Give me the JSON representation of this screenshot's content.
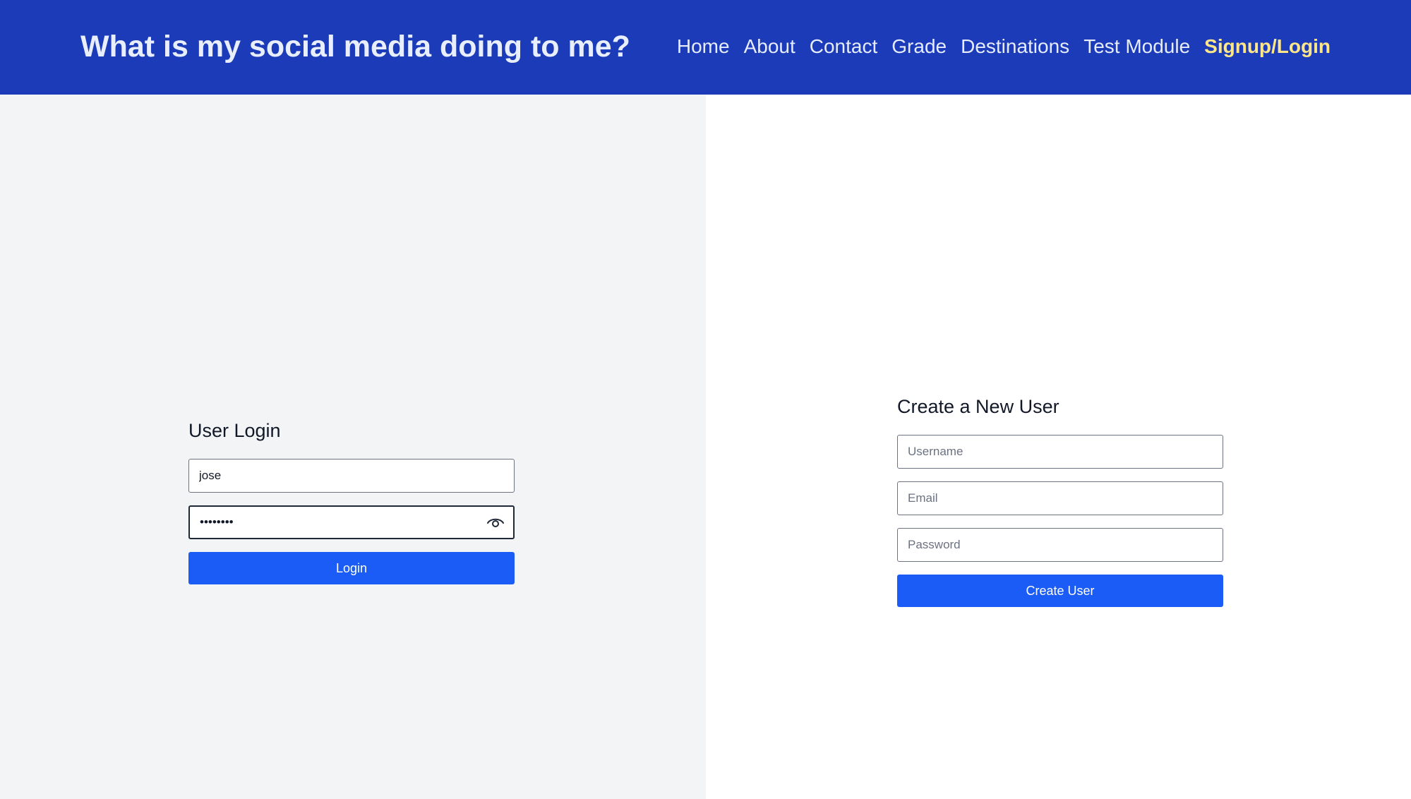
{
  "header": {
    "title": "What is my social media doing to me?",
    "nav": [
      {
        "label": "Home"
      },
      {
        "label": "About"
      },
      {
        "label": "Contact"
      },
      {
        "label": "Grade"
      },
      {
        "label": "Destinations"
      },
      {
        "label": "Test Module"
      },
      {
        "label": "Signup/Login",
        "active": true
      }
    ]
  },
  "login": {
    "title": "User Login",
    "username_value": "jose",
    "password_value": "********",
    "password_toggle_icon": "eye-icon",
    "button_label": "Login"
  },
  "create_user": {
    "title": "Create a New User",
    "username_placeholder": "Username",
    "email_placeholder": "Email",
    "password_placeholder": "Password",
    "button_label": "Create User"
  },
  "colors": {
    "header_bg": "#1c3bb8",
    "active_nav": "#fde68a",
    "button_bg": "#1a5cf5",
    "left_panel_bg": "#f3f4f6"
  }
}
